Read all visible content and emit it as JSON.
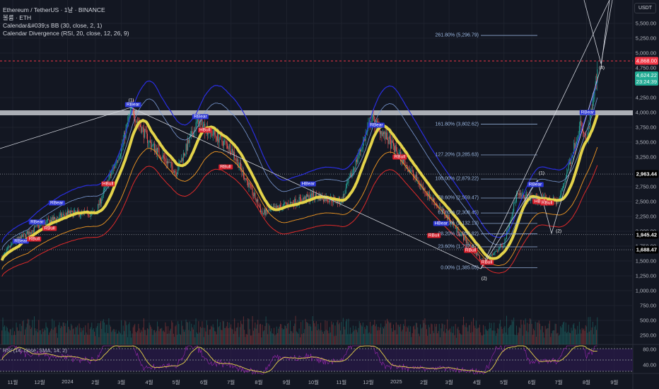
{
  "legend": {
    "symbol": "Ethereum / TetherUS · 1날 · BINANCE",
    "volume": "볼륨 · ETH",
    "bb": "Calendar&#039;s BB (30, close, 2, 1)",
    "div": "Calendar Divergence (RSI, 20, close, 12, 26, 9)"
  },
  "currency_button": "USDT",
  "price_axis": [
    "5,500.00",
    "5,250.00",
    "5,000.00",
    "4,750.00",
    "4,250.00",
    "4,000.00",
    "3,750.00",
    "3,500.00",
    "3,250.00",
    "2,750.00",
    "2,500.00",
    "2,250.00",
    "2,000.00",
    "1,750.00",
    "1,500.00",
    "1,250.00",
    "1,000.00",
    "750.00",
    "500.00",
    "250.00"
  ],
  "price_tags": {
    "alert": {
      "value": "4,868.00",
      "color": "#f23645"
    },
    "last": {
      "value": "4,624.22",
      "countdown": "23:24:39",
      "color": "#22ab94"
    },
    "lines": [
      "2,963.44",
      "1,945.42",
      "1,688.47"
    ]
  },
  "rsi": {
    "label": "RSI (14, close, SMA, 14, 2)",
    "axis": [
      "80.00",
      "40.00"
    ]
  },
  "time_axis": [
    "11월",
    "12월",
    "2024",
    "2월",
    "3월",
    "4월",
    "5월",
    "6월",
    "7월",
    "8월",
    "9월",
    "10월",
    "11월",
    "12월",
    "2025",
    "2월",
    "3월",
    "4월",
    "5월",
    "6월",
    "7월",
    "8월",
    "9월"
  ],
  "fib_levels": [
    {
      "label": "261.80% (5,296.79)",
      "price": 5296.79
    },
    {
      "label": "161.80% (3,802.62)",
      "price": 3802.62
    },
    {
      "label": "127.20% (3,285.63)",
      "price": 3285.63
    },
    {
      "label": "100.00% (2,879.22)",
      "price": 2879.22
    },
    {
      "label": "78.60% (2,559.47)",
      "price": 2559.47
    },
    {
      "label": "61.80% (2,308.45)",
      "price": 2308.45
    },
    {
      "label": "50.00% (2,132.13)",
      "price": 2132.13
    },
    {
      "label": "38.20% (1,955.82)",
      "price": 1955.82
    },
    {
      "label": "23.60% (1,737.67)",
      "price": 1737.67
    },
    {
      "label": "0.00% (1,385.05)",
      "price": 1385.05
    }
  ],
  "resistance_zone": 4000,
  "signals": [
    {
      "text": "RBear",
      "type": "bear",
      "date": "2023-11-10",
      "price": 1830
    },
    {
      "text": "RBear",
      "type": "bear",
      "date": "2023-11-28",
      "price": 2150
    },
    {
      "text": "RBear",
      "type": "bear",
      "date": "2023-12-20",
      "price": 2480
    },
    {
      "text": "RBull",
      "type": "bull",
      "date": "2023-11-25",
      "price": 1870
    },
    {
      "text": "RBull",
      "type": "bull",
      "date": "2023-12-12",
      "price": 2050
    },
    {
      "text": "HBull",
      "type": "bull",
      "date": "2024-02-15",
      "price": 2800
    },
    {
      "text": "RBear",
      "type": "bear",
      "date": "2024-03-14",
      "price": 4130
    },
    {
      "text": "RBear",
      "type": "bear",
      "date": "2024-05-28",
      "price": 3930
    },
    {
      "text": "HBull",
      "type": "bull",
      "date": "2024-06-02",
      "price": 3700
    },
    {
      "text": "RBull",
      "type": "bull",
      "date": "2024-06-25",
      "price": 3080
    },
    {
      "text": "HBear",
      "type": "bear",
      "date": "2024-09-25",
      "price": 2800
    },
    {
      "text": "RBear",
      "type": "bear",
      "date": "2024-12-10",
      "price": 3780
    },
    {
      "text": "RBull",
      "type": "bull",
      "date": "2025-01-05",
      "price": 3250
    },
    {
      "text": "HBear",
      "type": "bear",
      "date": "2025-02-20",
      "price": 2132
    },
    {
      "text": "RBull",
      "type": "bull",
      "date": "2025-02-12",
      "price": 1930
    },
    {
      "text": "RBull",
      "type": "bull",
      "date": "2025-03-25",
      "price": 1680
    },
    {
      "text": "RBull",
      "type": "bull",
      "date": "2025-04-12",
      "price": 1480
    },
    {
      "text": "RBear",
      "type": "bear",
      "date": "2025-06-05",
      "price": 2780
    },
    {
      "text": "HBull",
      "type": "bull",
      "date": "2025-06-10",
      "price": 2500
    },
    {
      "text": "RBull",
      "type": "bull",
      "date": "2025-06-18",
      "price": 2480
    },
    {
      "text": "RBear",
      "type": "bear",
      "date": "2025-08-02",
      "price": 4000
    }
  ],
  "waves": [
    {
      "text": "(1)",
      "date": "2024-03-12",
      "price": 4200
    },
    {
      "text": "(2)",
      "date": "2025-04-09",
      "price": 1200
    },
    {
      "text": "(1)",
      "date": "2025-06-12",
      "price": 2980
    },
    {
      "text": "(2)",
      "date": "2025-07-01",
      "price": 2000
    },
    {
      "text": "(4)",
      "date": "2025-08-18",
      "price": 4750
    }
  ],
  "colors": {
    "bull": "#26a69a",
    "bear": "#ef5350",
    "ma": "#e3d34a",
    "upper_band": "#2a2ee0",
    "lower_band": "#e02a2a",
    "mid_band": "#7c9bd6",
    "orange": "#f59a23",
    "rsi": "#e8d44a",
    "rsi_fill": "#2a1a4a"
  },
  "chart_data": {
    "type": "candlestick",
    "price_path": [
      [
        "2023-10-20",
        1550
      ],
      [
        "2023-11-01",
        1800
      ],
      [
        "2023-12-01",
        2100
      ],
      [
        "2024-01-01",
        2300
      ],
      [
        "2024-02-01",
        2300
      ],
      [
        "2024-03-01",
        3400
      ],
      [
        "2024-03-12",
        4050
      ],
      [
        "2024-04-01",
        3500
      ],
      [
        "2024-05-01",
        3000
      ],
      [
        "2024-05-25",
        3850
      ],
      [
        "2024-07-01",
        3400
      ],
      [
        "2024-08-05",
        2300
      ],
      [
        "2024-09-01",
        2450
      ],
      [
        "2024-10-01",
        2600
      ],
      [
        "2024-11-01",
        2500
      ],
      [
        "2024-12-05",
        3900
      ],
      [
        "2025-01-01",
        3350
      ],
      [
        "2025-02-01",
        2700
      ],
      [
        "2025-03-01",
        2200
      ],
      [
        "2025-04-09",
        1450
      ],
      [
        "2025-05-01",
        1800
      ],
      [
        "2025-05-15",
        2600
      ],
      [
        "2025-06-01",
        2550
      ],
      [
        "2025-07-01",
        2500
      ],
      [
        "2025-07-25",
        3800
      ],
      [
        "2025-08-01",
        3500
      ],
      [
        "2025-08-13",
        4624.22
      ]
    ]
  }
}
